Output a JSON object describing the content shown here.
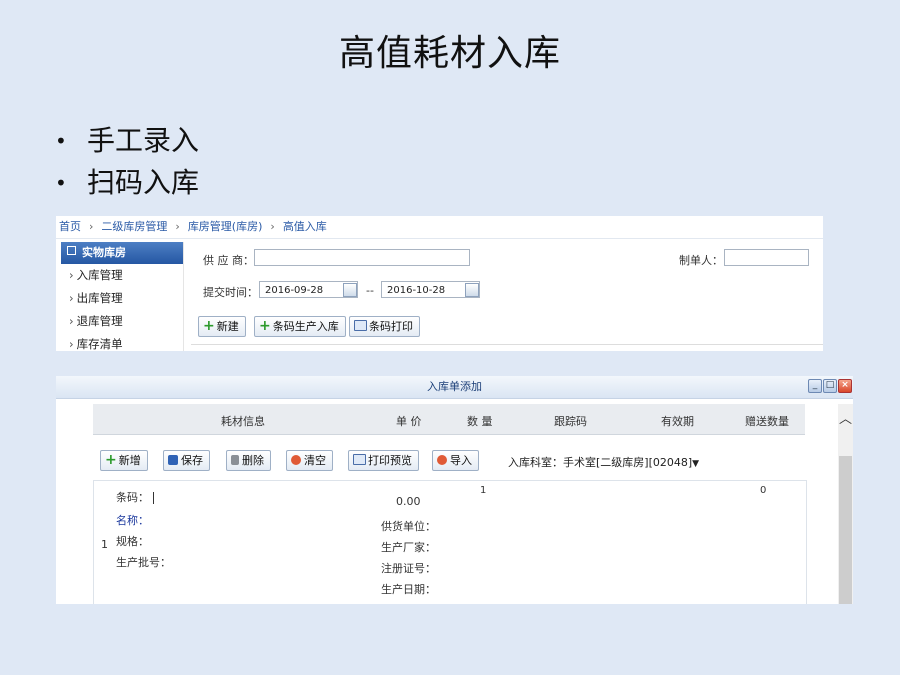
{
  "slide": {
    "title": "高值耗材入库",
    "bullets": [
      "手工录入",
      "扫码入库"
    ]
  },
  "shot1": {
    "breadcrumb": [
      "首页",
      "二级库房管理",
      "库房管理(库房)",
      "高值入库"
    ],
    "sidebar": {
      "header": "实物库房",
      "items": [
        "入库管理",
        "出库管理",
        "退库管理",
        "库存清单"
      ]
    },
    "filters": {
      "supplier_label": "供 应 商：",
      "supplier_value": "",
      "creator_label": "制单人：",
      "creator_value": "",
      "submit_time_label": "提交时间：",
      "date_from": "2016-09-28",
      "date_sep": "--",
      "date_to": "2016-10-28"
    },
    "buttons": {
      "new": "新建",
      "barcode_inbound": "条码生产入库",
      "barcode_print": "条码打印"
    }
  },
  "shot2": {
    "dialog_title": "入库单添加",
    "columns": [
      "耗材信息",
      "单 价",
      "数 量",
      "跟踪码",
      "有效期",
      "赠送数量"
    ],
    "toolbar": {
      "add": "新增",
      "save": "保存",
      "delete": "删除",
      "clear": "清空",
      "print_preview": "打印预览",
      "import": "导入"
    },
    "dept_label": "入库科室：",
    "dept_value": "手术室[二级库房][02048]",
    "row": {
      "index": "1",
      "barcode_label": "条码：",
      "name_label": "名称：",
      "spec_label": "规格：",
      "batch_label": "生产批号：",
      "price": "0.00",
      "quantity": "1",
      "gift_quantity": "0",
      "supplier_label": "供货单位：",
      "manufacturer_label": "生产厂家：",
      "reg_no_label": "注册证号：",
      "prod_date_label": "生产日期："
    }
  }
}
